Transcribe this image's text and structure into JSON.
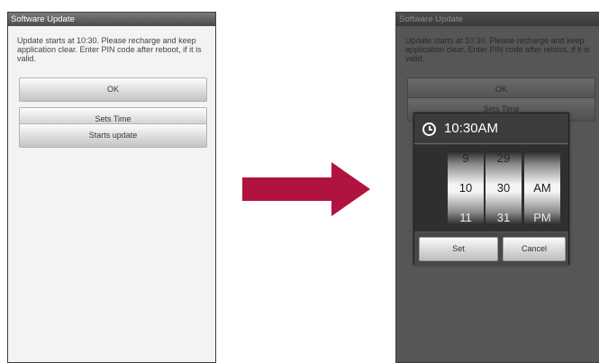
{
  "left_screen": {
    "title": "Software Update",
    "message": "Update starts at  10:30. Please recharge and keep application clear. Enter PIN code after reboot, if it is valid.",
    "buttons": [
      "OK",
      "Sets Time",
      "Starts update"
    ]
  },
  "arrow_color": "#b0133f",
  "right_screen": {
    "title": "Software Update",
    "message": "Update starts at  10:30. Please recharge and keep application clear. Enter PIN code after reboot, if it is valid.",
    "buttons": [
      "OK",
      "Sets Time"
    ],
    "time_picker": {
      "icon": "clock-icon",
      "title": "10:30AM",
      "hour": {
        "prev": "9",
        "current": "10",
        "next": "11"
      },
      "minute": {
        "prev": "29",
        "current": "30",
        "next": "31"
      },
      "ampm": {
        "current": "AM",
        "next": "PM"
      },
      "set_label": "Set",
      "cancel_label": "Cancel"
    }
  }
}
